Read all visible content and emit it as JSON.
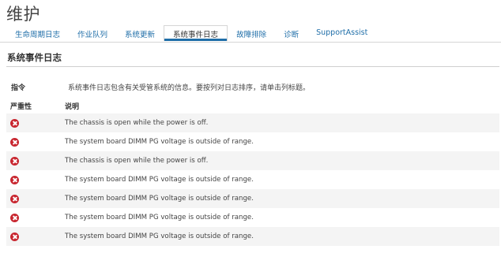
{
  "page": {
    "title": "维护"
  },
  "tabs": [
    {
      "label": "生命周期日志",
      "active": false
    },
    {
      "label": "作业队列",
      "active": false
    },
    {
      "label": "系统更新",
      "active": false
    },
    {
      "label": "系统事件日志",
      "active": true
    },
    {
      "label": "故障排除",
      "active": false
    },
    {
      "label": "诊断",
      "active": false
    },
    {
      "label": "SupportAssist",
      "active": false
    }
  ],
  "section": {
    "title": "系统事件日志",
    "instruction_label": "指令",
    "instruction_text": "系统事件日志包含有关受管系统的信息。要按列对日志排序，请单击列标题。"
  },
  "table": {
    "columns": {
      "severity": "严重性",
      "description": "说明"
    },
    "rows": [
      {
        "severity": "error-icon",
        "description": "The chassis is open while the power is off."
      },
      {
        "severity": "error-icon",
        "description": "The system board DIMM PG voltage is outside of range."
      },
      {
        "severity": "error-icon",
        "description": "The chassis is open while the power is off."
      },
      {
        "severity": "error-icon",
        "description": "The system board DIMM PG voltage is outside of range."
      },
      {
        "severity": "error-icon",
        "description": "The system board DIMM PG voltage is outside of range."
      },
      {
        "severity": "error-icon",
        "description": "The system board DIMM PG voltage is outside of range."
      },
      {
        "severity": "error-icon",
        "description": "The system board DIMM PG voltage is outside of range."
      }
    ]
  },
  "colors": {
    "link": "#1f6ea8",
    "error": "#c8262f",
    "row_alt": "#f4f4f4"
  }
}
